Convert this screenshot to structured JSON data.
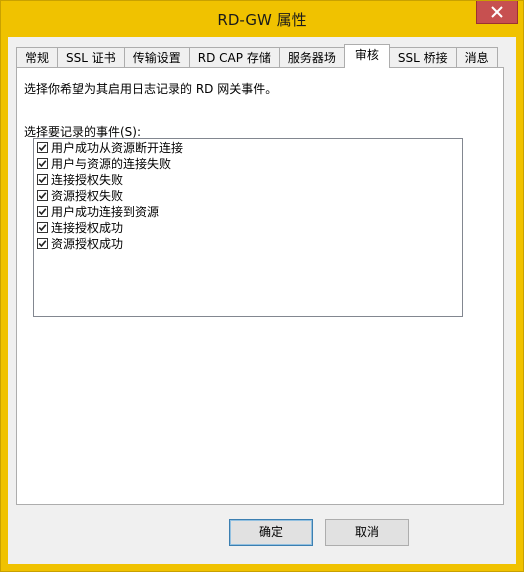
{
  "window": {
    "title": "RD-GW 属性"
  },
  "tabs": [
    {
      "label": "常规"
    },
    {
      "label": "SSL 证书"
    },
    {
      "label": "传输设置"
    },
    {
      "label": "RD CAP 存储"
    },
    {
      "label": "服务器场"
    },
    {
      "label": "审核"
    },
    {
      "label": "SSL 桥接"
    },
    {
      "label": "消息"
    }
  ],
  "panel": {
    "instruction": "选择你希望为其启用日志记录的 RD 网关事件。",
    "list_label": "选择要记录的事件(S):",
    "events": [
      {
        "label": "用户成功从资源断开连接",
        "checked": true
      },
      {
        "label": "用户与资源的连接失败",
        "checked": true
      },
      {
        "label": "连接授权失败",
        "checked": true
      },
      {
        "label": "资源授权失败",
        "checked": true
      },
      {
        "label": "用户成功连接到资源",
        "checked": true
      },
      {
        "label": "连接授权成功",
        "checked": true
      },
      {
        "label": "资源授权成功",
        "checked": true
      }
    ]
  },
  "buttons": {
    "ok": "确定",
    "cancel": "取消"
  },
  "colors": {
    "title_bar": "#f0c200",
    "close_button": "#c75050",
    "dialog_bg": "#f0f0f0"
  }
}
